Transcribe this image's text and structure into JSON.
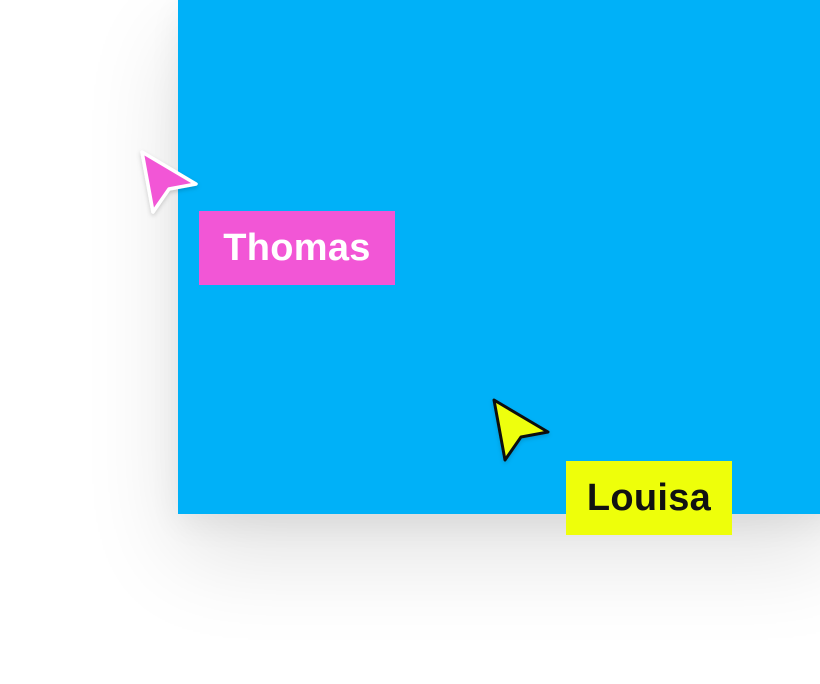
{
  "canvas": {
    "frame_color": "#00B1F8",
    "background_color": "#FFFFFF"
  },
  "collaborators": [
    {
      "name": "Thomas",
      "color": "#F256D6",
      "text_color": "#FFFFFF",
      "cursor_outline": "#FFFFFF",
      "icon": "pointer-cursor-icon"
    },
    {
      "name": "Louisa",
      "color": "#EEFF0A",
      "text_color": "#111111",
      "cursor_outline": "#111111",
      "icon": "pointer-cursor-icon"
    }
  ]
}
